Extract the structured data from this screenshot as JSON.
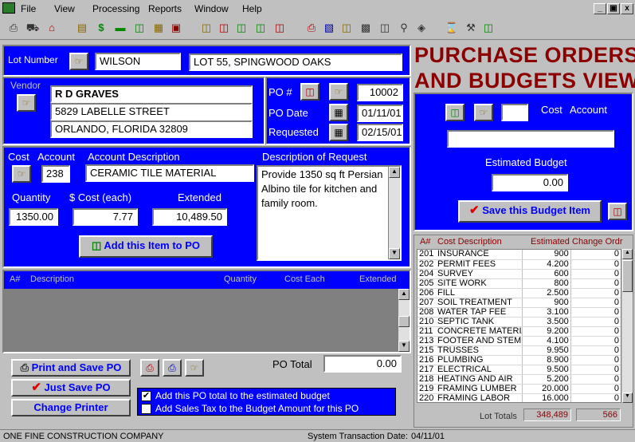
{
  "menu": {
    "file": "File",
    "view": "View",
    "processing": "Processing",
    "reports": "Reports",
    "window": "Window",
    "help": "Help"
  },
  "window_controls": {
    "minimize": "_",
    "restore": "▣",
    "close": "x"
  },
  "title": {
    "line1": "PURCHASE ORDERS",
    "line2": "AND BUDGETS VIEW"
  },
  "lot": {
    "label": "Lot Number",
    "value": "WILSON",
    "description": "LOT 55, SPINGWOOD OAKS"
  },
  "vendor": {
    "label": "Vendor",
    "name": "R D GRAVES",
    "street": "5829 LABELLE STREET",
    "city": "ORLANDO, FLORIDA 32809"
  },
  "po": {
    "number_label": "PO #",
    "number": "10002",
    "date_label": "PO Date",
    "date": "01/11/01",
    "requested_label": "Requested",
    "requested": "02/15/01"
  },
  "item": {
    "cost_label": "Cost",
    "account_label": "Account",
    "account": "238",
    "desc_label": "Account Description",
    "account_description": "CERAMIC TILE MATERIAL",
    "request_label": "Description of Request",
    "request_text": "Provide 1350 sq ft Persian Albino tile for kitchen and family room.",
    "quantity_label": "Quantity",
    "quantity": "1350.00",
    "cost_each_label": "$ Cost (each)",
    "cost_each": "7.77",
    "extended_label": "Extended",
    "extended": "10,489.50",
    "add_button": "Add this Item to PO"
  },
  "po_grid": {
    "col_num": "A#",
    "col_desc": "Description",
    "col_qty": "Quantity",
    "col_cost": "Cost Each",
    "col_ext": "Extended"
  },
  "actions": {
    "print_save": "Print and Save PO",
    "just_save": "Just Save PO",
    "change_printer": "Change Printer",
    "po_total_label": "PO Total",
    "po_total": "0.00"
  },
  "options": {
    "add_total": "Add this PO total to the estimated budget",
    "add_tax": "Add Sales Tax to the Budget Amount for this PO",
    "add_total_checked": true,
    "add_tax_checked": false
  },
  "budget": {
    "cost_label": "Cost",
    "account_label": "Account",
    "account": "",
    "description": "",
    "estimated_label": "Estimated Budget",
    "estimated": "0.00",
    "save_button": "Save this Budget Item"
  },
  "budget_grid": {
    "col_num": "A#",
    "col_desc": "Cost Description",
    "col_est": "Estimated",
    "col_change": "Change Ordr",
    "rows": [
      [
        "201",
        "INSURANCE",
        "900",
        "0"
      ],
      [
        "202",
        "PERMIT FEES",
        "4.200",
        "0"
      ],
      [
        "204",
        "SURVEY",
        "600",
        "0"
      ],
      [
        "205",
        "SITE WORK",
        "800",
        "0"
      ],
      [
        "206",
        "FILL",
        "2.500",
        "0"
      ],
      [
        "207",
        "SOIL TREATMENT",
        "900",
        "0"
      ],
      [
        "208",
        "WATER TAP FEE",
        "3.100",
        "0"
      ],
      [
        "210",
        "SEPTIC TANK",
        "3.500",
        "0"
      ],
      [
        "211",
        "CONCRETE MATERIAL",
        "9.200",
        "0"
      ],
      [
        "213",
        "FOOTER AND STEM W",
        "4.100",
        "0"
      ],
      [
        "215",
        "TRUSSES",
        "9.950",
        "0"
      ],
      [
        "216",
        "PLUMBING",
        "8.900",
        "0"
      ],
      [
        "217",
        "ELECTRICAL",
        "9.500",
        "0"
      ],
      [
        "218",
        "HEATING AND AIR",
        "5.200",
        "0"
      ],
      [
        "219",
        "FRAMING LUMBER",
        "20.000",
        "0"
      ],
      [
        "220",
        "FRAMING LABOR",
        "16.000",
        "0"
      ]
    ],
    "totals_label": "Lot Totals",
    "total_estimated": "348,489",
    "total_change": "566"
  },
  "status": {
    "company": "ONE FINE CONSTRUCTION COMPANY",
    "date_label": "System Transaction Date:",
    "date": "04/11/01"
  }
}
